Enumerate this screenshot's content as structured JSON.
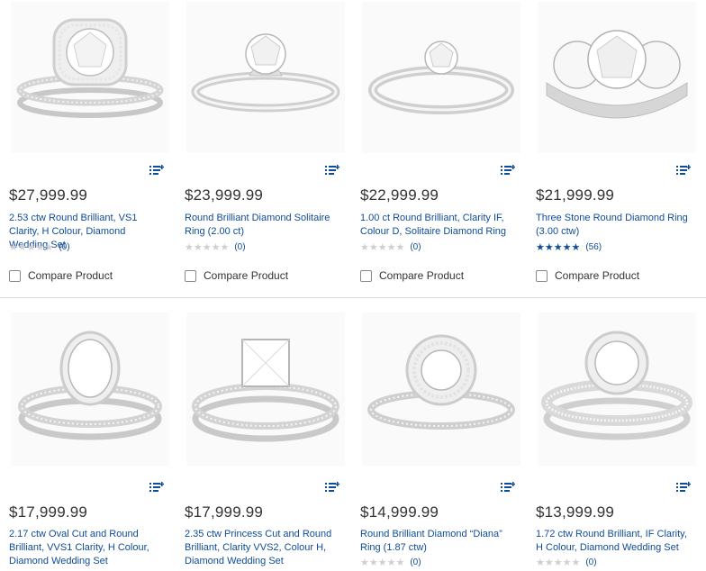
{
  "colors": {
    "link": "#0f4c97",
    "price": "#333333",
    "divider": "#d9d9d9"
  },
  "icons": {
    "add_to_list": "list-add-icon",
    "star": "star-icon"
  },
  "products": [
    {
      "price": "$27,999.99",
      "title": "2.53 ctw Round Brilliant, VS1 Clarity, H Colour, Diamond Wedding Set",
      "rating": 0,
      "review_count": "(0)",
      "compare_label": "Compare Product",
      "image": "halo-wedding-set"
    },
    {
      "price": "$23,999.99",
      "title": "Round Brilliant Diamond Solitaire Ring (2.00 ct)",
      "rating": 0,
      "review_count": "(0)",
      "compare_label": "Compare Product",
      "image": "solitaire-six-prong"
    },
    {
      "price": "$22,999.99",
      "title": "1.00 ct Round Brilliant, Clarity IF, Colour D, Solitaire Diamond Ring",
      "rating": 0,
      "review_count": "(0)",
      "compare_label": "Compare Product",
      "image": "solitaire-tapered"
    },
    {
      "price": "$21,999.99",
      "title": "Three Stone Round Diamond Ring (3.00 ctw)",
      "rating": 5,
      "review_count": "(56)",
      "compare_label": "Compare Product",
      "image": "three-stone"
    },
    {
      "price": "$17,999.99",
      "title": "2.17 ctw Oval Cut and Round Brilliant, VVS1 Clarity, H Colour, Diamond Wedding Set",
      "rating": null,
      "review_count": "",
      "compare_label": "",
      "image": "oval-halo-set"
    },
    {
      "price": "$17,999.99",
      "title": "2.35 ctw Princess Cut and Round Brilliant, Clarity VVS2, Colour H, Diamond Wedding Set",
      "rating": null,
      "review_count": "",
      "compare_label": "",
      "image": "princess-set"
    },
    {
      "price": "$14,999.99",
      "title": "Round Brilliant Diamond “Diana” Ring (1.87 ctw)",
      "rating": 0,
      "review_count": "(0)",
      "compare_label": "",
      "image": "diana-halo"
    },
    {
      "price": "$13,999.99",
      "title": "1.72 ctw Round Brilliant, IF Clarity, H Colour, Diamond Wedding Set",
      "rating": 0,
      "review_count": "(0)",
      "compare_label": "",
      "image": "pave-halo-set"
    }
  ]
}
